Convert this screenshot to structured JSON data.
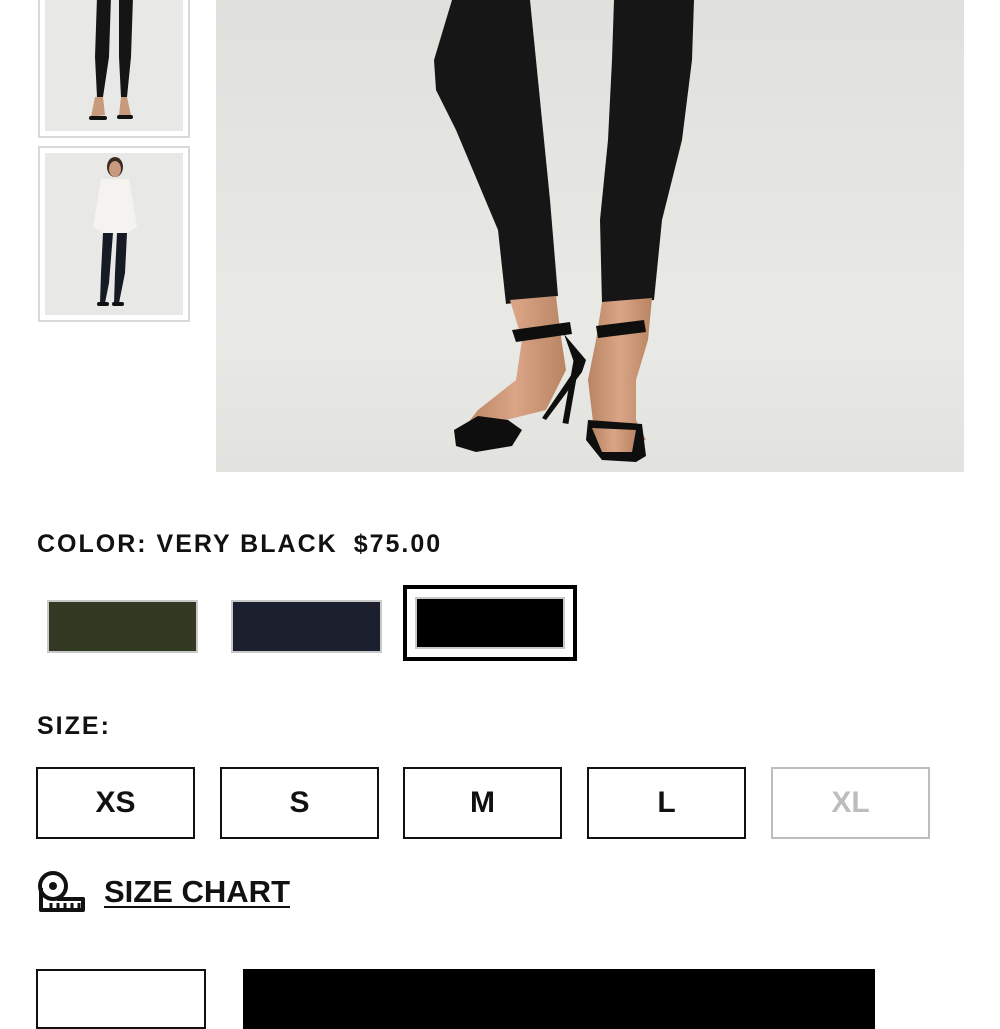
{
  "product": {
    "color_label": "COLOR: VERY BLACK",
    "price": "$75.00",
    "colors": [
      {
        "name": "olive",
        "hex": "#333a23",
        "selected": false
      },
      {
        "name": "navy",
        "hex": "#1c1f2e",
        "selected": false
      },
      {
        "name": "very-black",
        "hex": "#000000",
        "selected": true
      }
    ],
    "size_label": "SIZE:",
    "sizes": [
      {
        "label": "XS",
        "available": true
      },
      {
        "label": "S",
        "available": true
      },
      {
        "label": "M",
        "available": true
      },
      {
        "label": "L",
        "available": true
      },
      {
        "label": "XL",
        "available": false
      }
    ],
    "size_chart_label": "SIZE CHART",
    "size_chart_icon": "measuring-tape-icon"
  },
  "colors": {
    "text": "#111111",
    "disabled": "#bdbdbd",
    "swatch_border": "#c9c9c9",
    "selected_border": "#000000",
    "image_bg": "#e6e6e3"
  }
}
